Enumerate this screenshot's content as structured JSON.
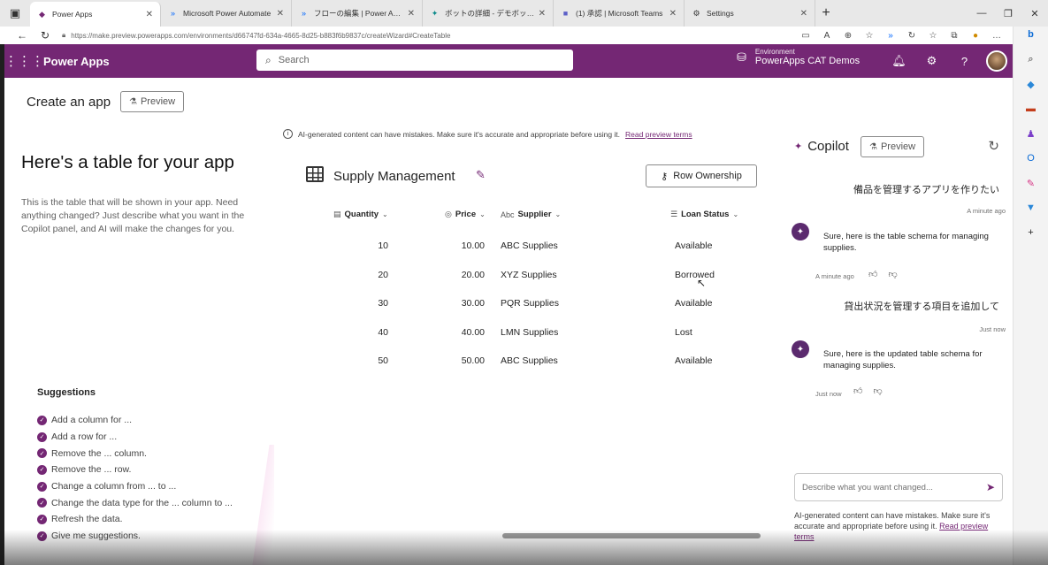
{
  "browser": {
    "tabs": [
      {
        "label": "Power Apps",
        "icon": "power-apps-icon",
        "active": true
      },
      {
        "label": "Microsoft Power Automate",
        "icon": "power-automate-icon"
      },
      {
        "label": "フローの編集 | Power Automate",
        "icon": "power-automate-icon"
      },
      {
        "label": "ボットの詳細 - デモボット | Power Vi",
        "icon": "power-virtual-agents-icon"
      },
      {
        "label": "(1) 承認 | Microsoft Teams",
        "icon": "teams-icon"
      },
      {
        "label": "Settings",
        "icon": "gear-icon"
      }
    ],
    "url": "https://make.preview.powerapps.com/environments/d66747fd-634a-4665-8d25-b883f6b9837c/createWizard#CreateTable"
  },
  "header": {
    "app_name": "Power Apps",
    "search_placeholder": "Search",
    "env_label": "Environment",
    "env_name": "PowerApps CAT Demos"
  },
  "page": {
    "title": "Create an app",
    "preview_label": "Preview"
  },
  "left": {
    "heading": "Here's a table for your app",
    "description": "This is the table that will be shown in your app. Need anything changed? Just describe what you want in the Copilot panel, and AI will make the changes for you.",
    "suggestions_title": "Suggestions",
    "suggestions": [
      "Add a column for ...",
      "Add a row for ...",
      "Remove the ... column.",
      "Remove the ... row.",
      "Change a column from ... to ...",
      "Change the data type for the ... column to ...",
      "Refresh the data.",
      "Give me suggestions."
    ]
  },
  "notice": {
    "text": "AI-generated content can have mistakes. Make sure it's accurate and appropriate before using it.",
    "link": "Read preview terms"
  },
  "table": {
    "title": "Supply Management",
    "row_ownership_label": "Row Ownership",
    "columns": [
      "Quantity",
      "Price",
      "Supplier",
      "Loan Status"
    ],
    "rows": [
      {
        "quantity": "10",
        "price": "10.00",
        "supplier": "ABC Supplies",
        "status": "Available"
      },
      {
        "quantity": "20",
        "price": "20.00",
        "supplier": "XYZ Supplies",
        "status": "Borrowed"
      },
      {
        "quantity": "30",
        "price": "30.00",
        "supplier": "PQR Supplies",
        "status": "Available"
      },
      {
        "quantity": "40",
        "price": "40.00",
        "supplier": "LMN Supplies",
        "status": "Lost"
      },
      {
        "quantity": "50",
        "price": "50.00",
        "supplier": "ABC Supplies",
        "status": "Available"
      }
    ]
  },
  "copilot": {
    "title": "Copilot",
    "preview_label": "Preview",
    "messages": [
      {
        "role": "user",
        "text": "備品を管理するアプリを作りたい",
        "time": "A minute ago"
      },
      {
        "role": "bot",
        "text": "Sure, here is the table schema for managing supplies.",
        "time": "A minute ago"
      },
      {
        "role": "user",
        "text": "貸出状況を管理する項目を追加して",
        "time": "Just now"
      },
      {
        "role": "bot",
        "text": "Sure, here is the updated table schema for managing supplies.",
        "time": "Just now"
      }
    ],
    "input_placeholder": "Describe what you want changed...",
    "footer_text": "AI-generated content can have mistakes. Make sure it's accurate and appropriate before using it.",
    "footer_link": "Read preview terms"
  },
  "colors": {
    "brand": "#742774",
    "link": "#742774"
  }
}
